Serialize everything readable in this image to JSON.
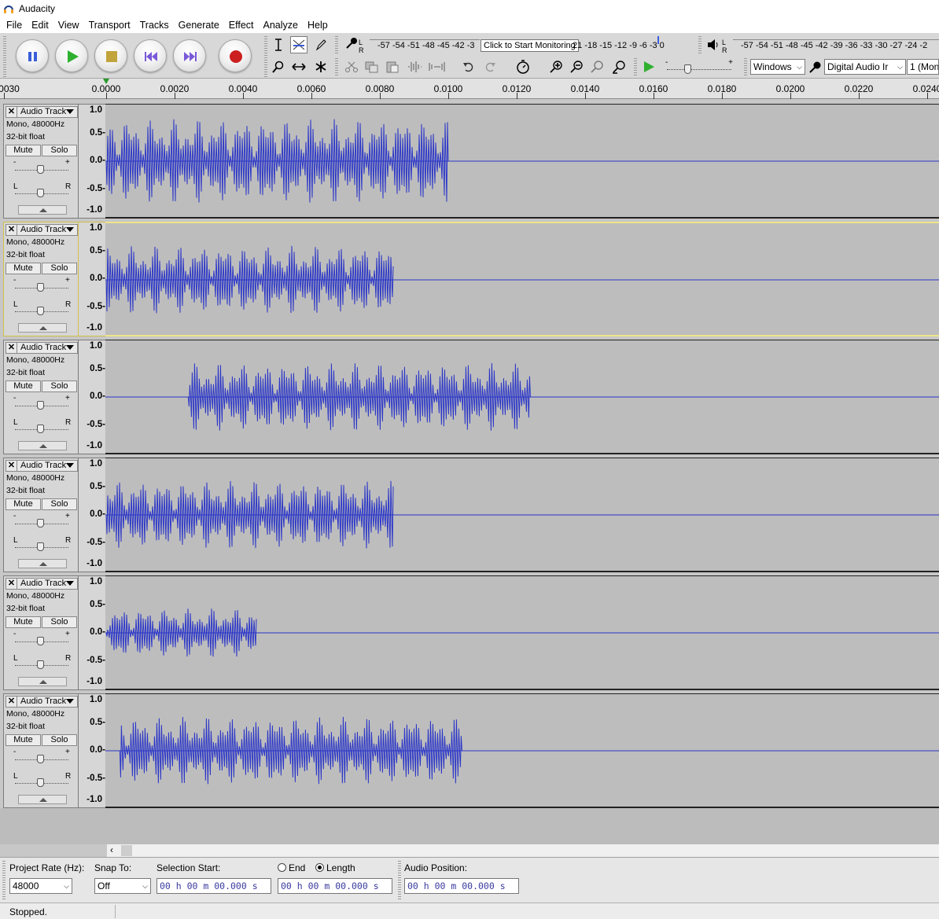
{
  "window": {
    "title": "Audacity"
  },
  "menu": [
    "File",
    "Edit",
    "View",
    "Transport",
    "Tracks",
    "Generate",
    "Effect",
    "Analyze",
    "Help"
  ],
  "transport": {
    "pause": "pause-icon",
    "play": "play-icon",
    "stop": "stop-icon",
    "skip_start": "skip-start-icon",
    "skip_end": "skip-end-icon",
    "record": "record-icon"
  },
  "meters": {
    "record_scale": "-57 -54 -51 -48 -45 -42 -3",
    "record_scale_tail": "21 -18 -15 -12 -9 -6 -3 0",
    "tooltip": "Click to Start Monitoring",
    "playback_scale": "-57 -54 -51 -48 -45 -42 -39 -36 -33 -30 -27 -24 -2"
  },
  "device": {
    "host": "Windows",
    "input": "Digital Audio Ir",
    "channels": "1 (Mon"
  },
  "ruler": {
    "labels": [
      "-0.0030",
      "0.0000",
      "0.0020",
      "0.0040",
      "0.0060",
      "0.0080",
      "0.0100",
      "0.0120",
      "0.0140",
      "0.0160",
      "0.0180",
      "0.0200",
      "0.0220",
      "0.0240"
    ]
  },
  "track_common": {
    "name": "Audio Track",
    "line1": "Mono, 48000Hz",
    "line2": "32-bit float",
    "mute": "Mute",
    "solo": "Solo",
    "minus": "-",
    "plus": "+",
    "left": "L",
    "right": "R",
    "scale": [
      "1.0",
      "0.5-",
      "0.0-",
      "-0.5-",
      "-1.0"
    ]
  },
  "tracks": [
    {
      "start": 0.0,
      "end": 0.01,
      "peak": 0.62
    },
    {
      "start": 0.0,
      "end": 0.0084,
      "peak": 0.5
    },
    {
      "start": 0.0024,
      "end": 0.0124,
      "peak": 0.5
    },
    {
      "start": 0.0,
      "end": 0.0084,
      "peak": 0.5
    },
    {
      "start": 0.0,
      "end": 0.0044,
      "peak": 0.36
    },
    {
      "start": 0.0004,
      "end": 0.0104,
      "peak": 0.5
    }
  ],
  "selection_toolbar": {
    "project_rate_label": "Project Rate (Hz):",
    "project_rate": "48000",
    "snap_label": "Snap To:",
    "snap": "Off",
    "sel_start_label": "Selection Start:",
    "end_label": "End",
    "length_label": "Length",
    "sel_start": "00 h 00 m 00.000 s",
    "sel_len": "00 h 00 m 00.000 s",
    "audio_pos_label": "Audio Position:",
    "audio_pos": "00 h 00 m 00.000 s"
  },
  "status": "Stopped."
}
